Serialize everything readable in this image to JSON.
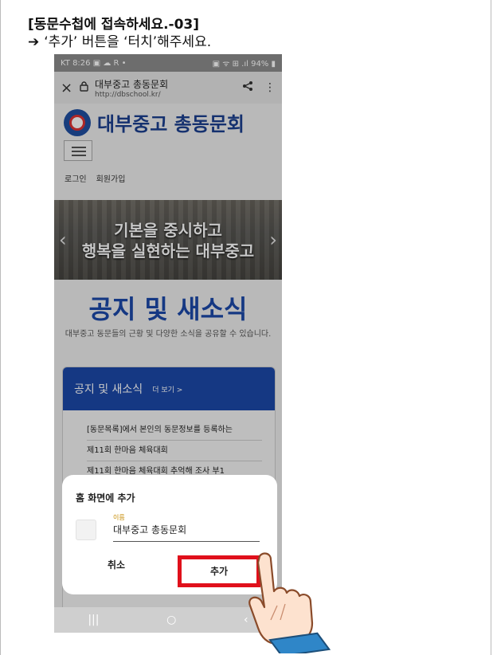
{
  "document": {
    "title": "[동문수첩에 접속하세요.-03]",
    "instruction_arrow": "➔",
    "instruction": "‘추가’ 버튼을 ‘터치’해주세요."
  },
  "phone": {
    "status": {
      "left": "KT 8:26 ▣ ☁ R •",
      "right": "▣ ᯤ ⊞ .ıl 94% ▮"
    },
    "browser": {
      "close_icon": "×",
      "lock_icon": "🔒",
      "site_name": "대부중고 총동문회",
      "url": "http://dbschool.kr/",
      "share_icon": "<",
      "more_icon": "⋮"
    },
    "site": {
      "name": "대부중고 총동문회",
      "nav": [
        "로그인",
        "회원가입"
      ],
      "banner_line1": "기본을 중시하고",
      "banner_line2": "행복을 실현하는 대부중고",
      "banner_prev": "‹",
      "banner_next": "›",
      "section_title": "공지 및 새소식",
      "section_desc": "대부중고 동문들의 근황 및 다양한 소식을 공유할 수 있습니다.",
      "notice_header": "공지 및 새소식",
      "notice_more": "더 보기 >",
      "notices": [
        "[동문목록]에서 본인의 동문정보를 등록하는",
        "제11회 한마음 체육대회",
        "제11회 한마음 체육대회 추억해 조사 부1"
      ]
    },
    "dialog": {
      "title": "홈 화면에 추가",
      "field_label": "이름",
      "field_value": "대부중고 총동문회",
      "cancel_label": "취소",
      "add_label": "추가"
    },
    "navbar": {
      "recent": "|||",
      "home": "○",
      "back": "‹"
    }
  },
  "colors": {
    "accent": "#1c48a8",
    "highlight": "#e0101b"
  },
  "icons": [
    "close-icon",
    "lock-icon",
    "share-icon",
    "more-icon",
    "menu-icon",
    "pointing-hand-icon"
  ]
}
